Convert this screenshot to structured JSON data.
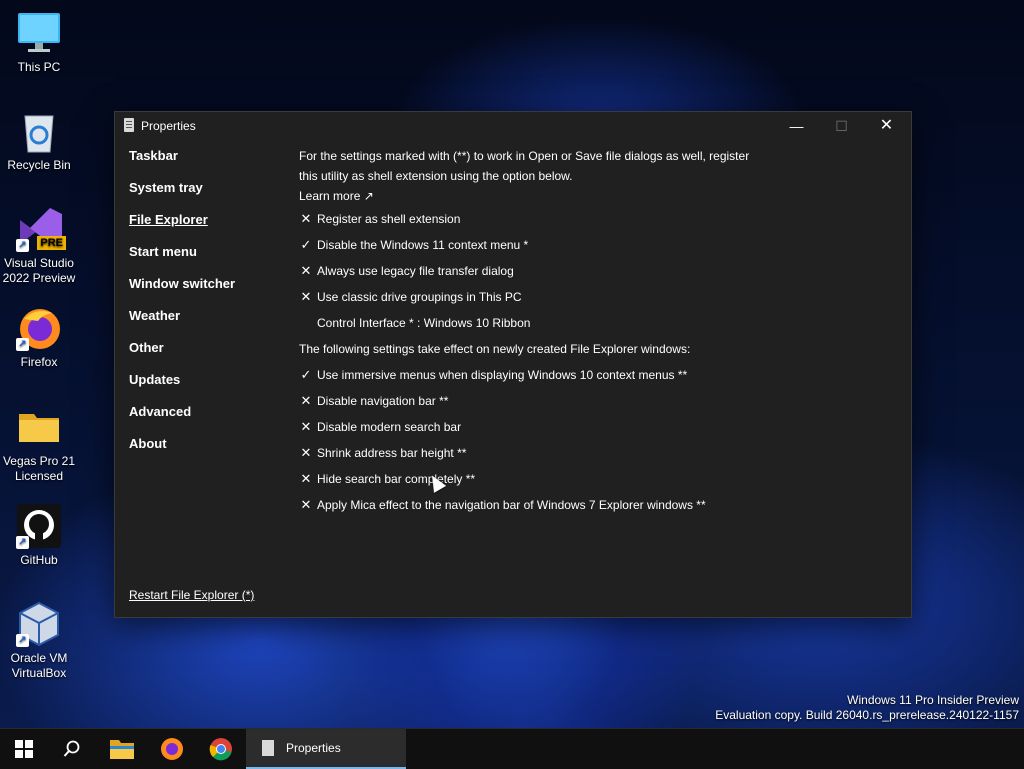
{
  "desktop": {
    "icons": [
      {
        "label": "This PC",
        "icon": "monitor-icon"
      },
      {
        "label": "Recycle Bin",
        "icon": "recycle-bin-icon"
      },
      {
        "label": "Visual Studio 2022 Preview",
        "icon": "visual-studio-icon",
        "badge": "PRE"
      },
      {
        "label": "Firefox",
        "icon": "firefox-icon"
      },
      {
        "label": "Vegas Pro 21 Licensed",
        "icon": "folder-icon"
      },
      {
        "label": "GitHub",
        "icon": "github-icon"
      },
      {
        "label": "Oracle VM VirtualBox",
        "icon": "virtualbox-icon"
      }
    ],
    "watermark_line1": "Windows 11 Pro Insider Preview",
    "watermark_line2": "Evaluation copy. Build 26040.rs_prerelease.240122-1157"
  },
  "window": {
    "title": "Properties",
    "controls": {
      "minimize": "—",
      "maximize": "☐",
      "close": "✕"
    },
    "nav": [
      {
        "label": "Taskbar",
        "active": false
      },
      {
        "label": "System tray",
        "active": false
      },
      {
        "label": "File Explorer",
        "active": true
      },
      {
        "label": "Start menu",
        "active": false
      },
      {
        "label": "Window switcher",
        "active": false
      },
      {
        "label": "Weather",
        "active": false
      },
      {
        "label": "Other",
        "active": false
      },
      {
        "label": "Updates",
        "active": false
      },
      {
        "label": "Advanced",
        "active": false
      },
      {
        "label": "About",
        "active": false
      }
    ],
    "restart_link": "Restart File Explorer (*)",
    "content": {
      "intro": "For the settings marked with (**) to work in Open or Save file dialogs as well, register this utility as shell extension using the option below.",
      "learn_more": "Learn more ↗",
      "options_a": [
        {
          "mark": "✕",
          "label": "Register as shell extension"
        },
        {
          "mark": "✓",
          "label": "Disable the Windows 11 context menu *"
        },
        {
          "mark": "✕",
          "label": "Always use legacy file transfer dialog"
        },
        {
          "mark": "✕",
          "label": "Use classic drive groupings in This PC"
        },
        {
          "mark": "",
          "label": "Control Interface * : Windows 10 Ribbon"
        }
      ],
      "section_note": "The following settings take effect on newly created File Explorer windows:",
      "options_b": [
        {
          "mark": "✓",
          "label": "Use immersive menus when displaying Windows 10 context menus **"
        },
        {
          "mark": "✕",
          "label": "Disable navigation bar **"
        },
        {
          "mark": "✕",
          "label": "Disable modern search bar"
        },
        {
          "mark": "✕",
          "label": "Shrink address bar height **"
        },
        {
          "mark": "✕",
          "label": "Hide search bar completely **"
        },
        {
          "mark": "✕",
          "label": "Apply Mica effect to the navigation bar of Windows 7 Explorer windows **"
        }
      ]
    }
  },
  "taskbar": {
    "items": [
      {
        "icon": "windows-start-icon"
      },
      {
        "icon": "search-icon"
      },
      {
        "icon": "file-explorer-icon"
      },
      {
        "icon": "firefox-icon"
      },
      {
        "icon": "chrome-icon"
      }
    ],
    "active_label": "Properties"
  },
  "colors": {
    "accent": "#76b9ed",
    "window_bg": "#202020",
    "taskbar_bg": "#101010"
  }
}
